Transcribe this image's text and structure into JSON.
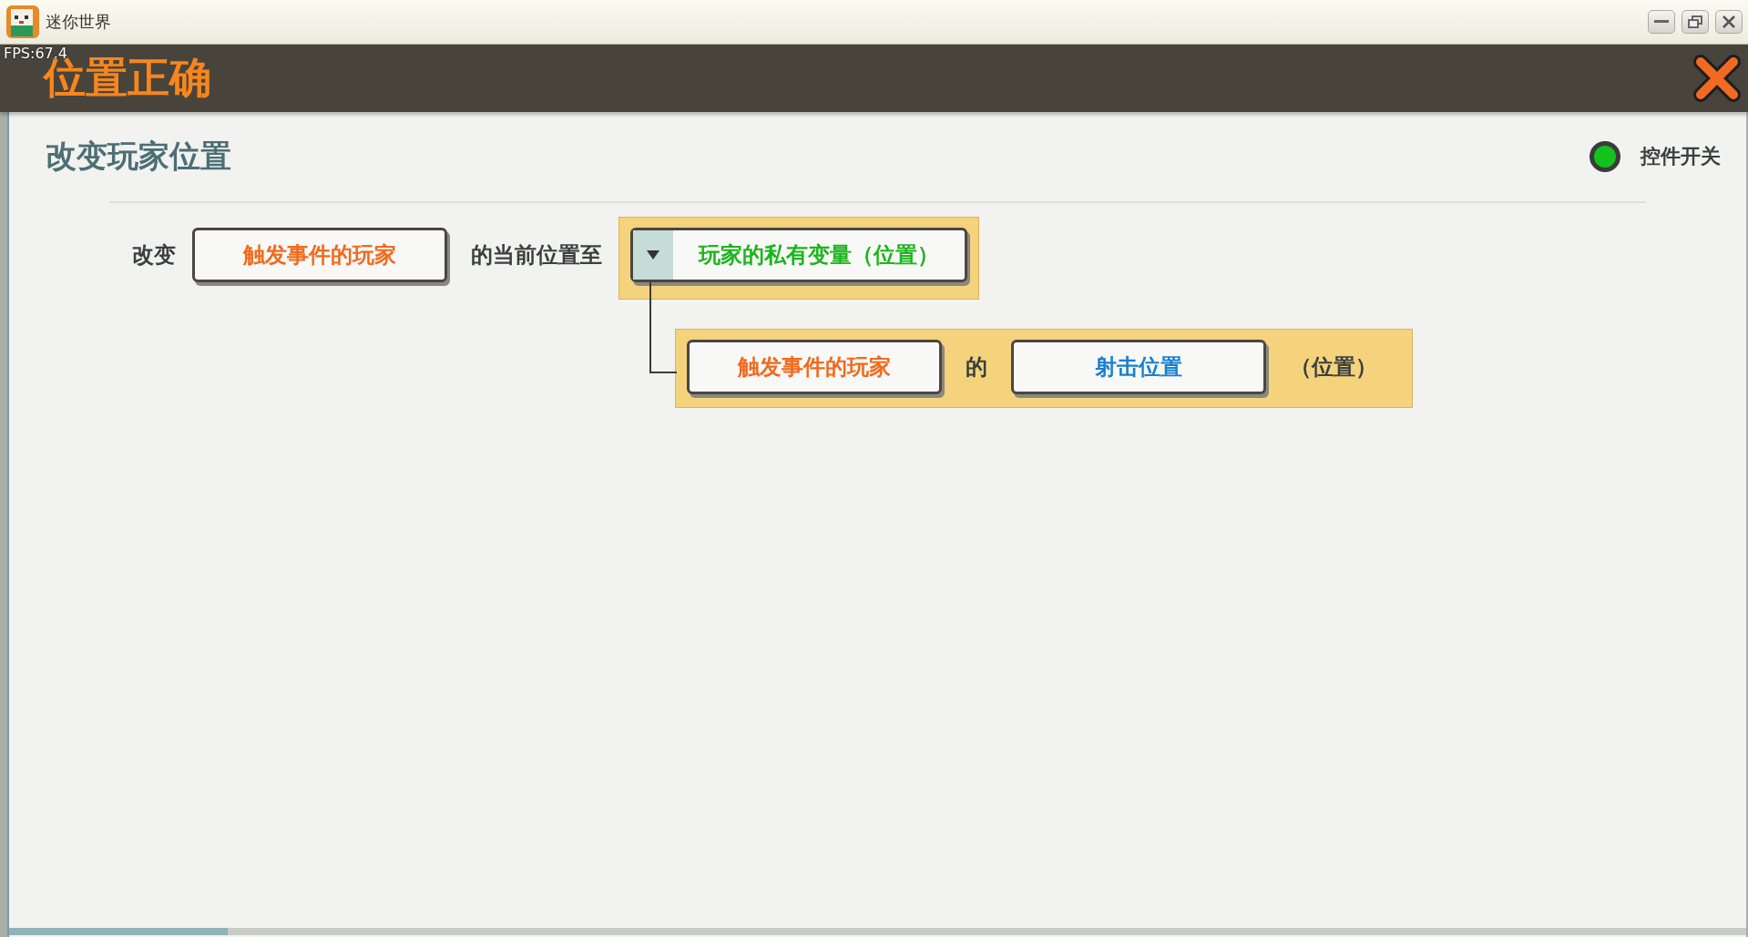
{
  "window": {
    "title": "迷你世界"
  },
  "fps": "FPS:67.4",
  "header": {
    "title": "位置正确"
  },
  "trigger": {
    "title": "改变玩家位置",
    "toggle": {
      "label": "控件开关",
      "on": true
    }
  },
  "action": {
    "parts": [
      {
        "kind": "text",
        "text": "改变"
      },
      {
        "kind": "slot",
        "text": "触发事件的玩家",
        "color": "#f06a1e"
      },
      {
        "kind": "text",
        "text": "的当前位置至"
      },
      {
        "kind": "dropdown",
        "text": "玩家的私有变量（位置）",
        "color": "#1db41d",
        "expanded": true,
        "children": [
          {
            "kind": "slot",
            "text": "触发事件的玩家",
            "color": "#f06a1e"
          },
          {
            "kind": "text",
            "text": "的"
          },
          {
            "kind": "slot",
            "text": "射击位置",
            "color": "#1a7fcf"
          },
          {
            "kind": "text",
            "text": "（位置）"
          }
        ]
      }
    ]
  }
}
